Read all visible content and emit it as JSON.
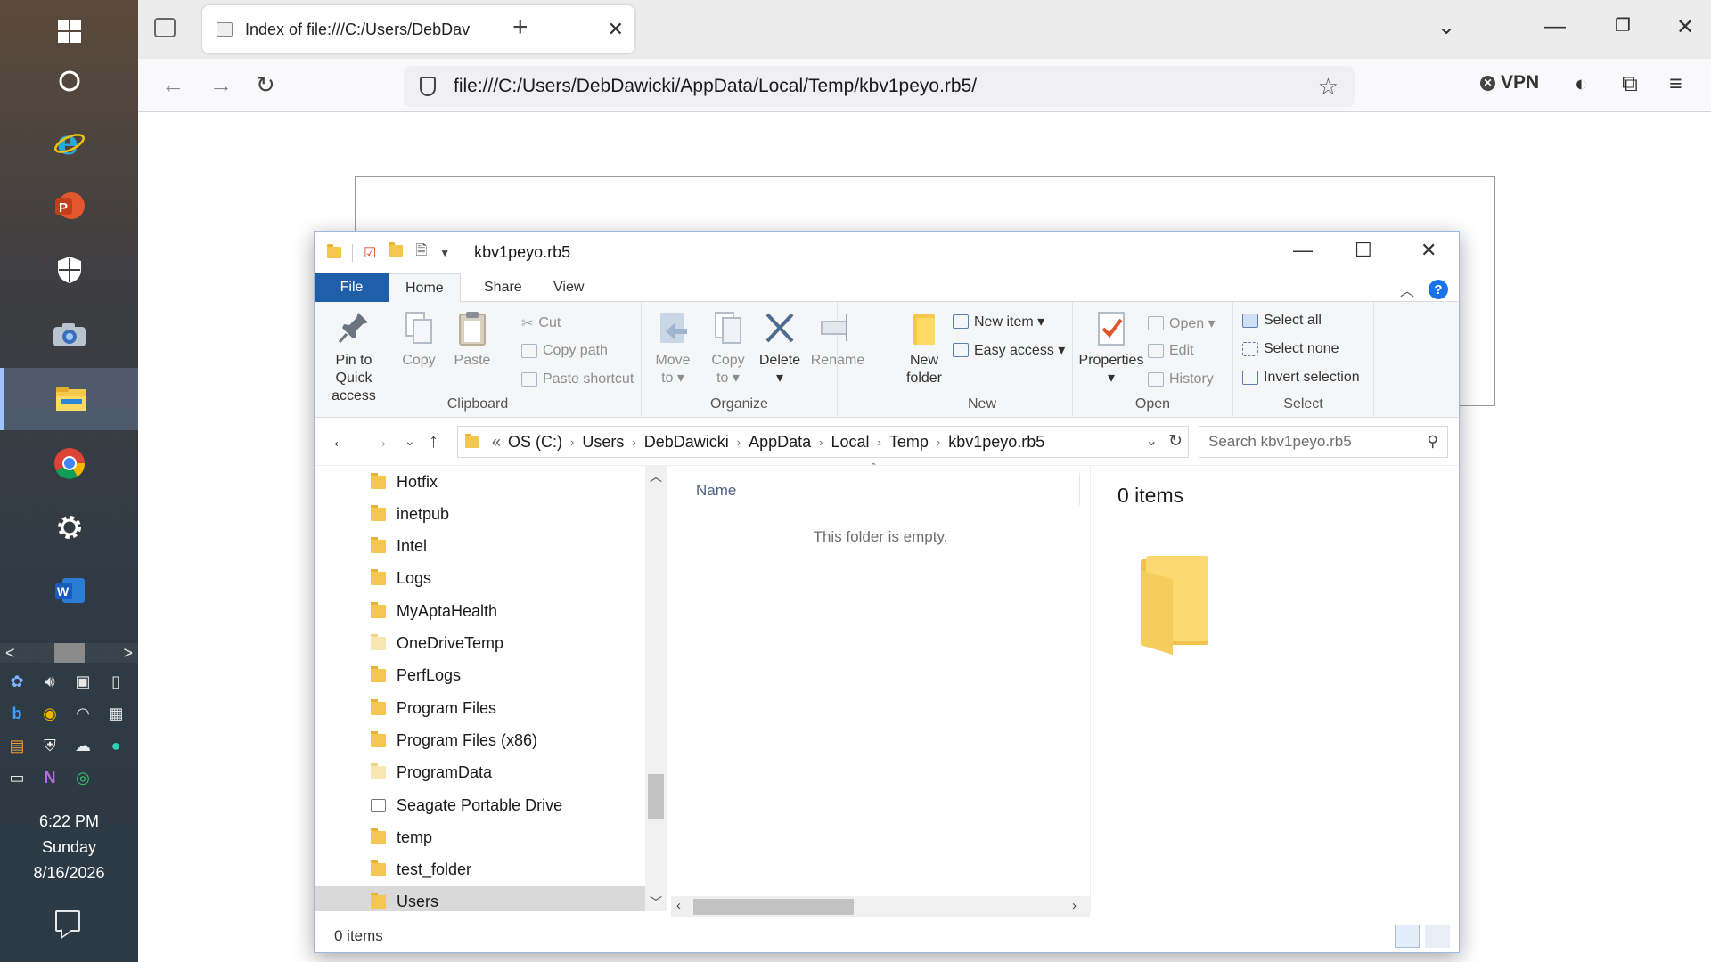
{
  "taskbar": {
    "icons": [
      "windows-start-icon",
      "cortana-icon",
      "internet-explorer-icon",
      "powerpoint-icon",
      "windows-security-icon",
      "camera-icon",
      "file-explorer-icon",
      "chrome-icon",
      "settings-icon",
      "word-icon"
    ],
    "tray_icons": [
      "copilot-icon",
      "volume-icon",
      "meet-now-icon",
      "battery-icon",
      "bing-icon",
      "chrome-icon",
      "wifi-icon",
      "camera-app-icon",
      "app-icon",
      "security-icon",
      "onedrive-icon",
      "app-icon",
      "drive-icon",
      "onenote-icon",
      "app-icon"
    ],
    "clock": {
      "time": "6:22 PM",
      "day": "Sunday",
      "date": "8/16/2026"
    }
  },
  "browser": {
    "tab_title": "Index of file:///C:/Users/DebDav",
    "tab_close": "✕",
    "new_tab": "+",
    "url": "file:///C:/Users/DebDawicki/AppData/Local/Temp/kbv1peyo.rb5/",
    "vpn_label": "VPN"
  },
  "explorer": {
    "window_title": "kbv1peyo.rb5",
    "ribbon_tabs": [
      "File",
      "Home",
      "Share",
      "View"
    ],
    "clipboard": {
      "pin_line1": "Pin to Quick",
      "pin_line2": "access",
      "copy": "Copy",
      "paste": "Paste",
      "cut": "Cut",
      "copy_path": "Copy path",
      "paste_shortcut": "Paste shortcut",
      "label": "Clipboard"
    },
    "organize": {
      "move_line1": "Move",
      "move_line2": "to ▾",
      "copy_line1": "Copy",
      "copy_line2": "to ▾",
      "delete": "Delete",
      "rename": "Rename",
      "label": "Organize"
    },
    "new": {
      "new_folder_line1": "New",
      "new_folder_line2": "folder",
      "new_item": "New item ▾",
      "easy_access": "Easy access ▾",
      "label": "New"
    },
    "open": {
      "properties": "Properties",
      "open": "Open ▾",
      "edit": "Edit",
      "history": "History",
      "label": "Open"
    },
    "select": {
      "select_all": "Select all",
      "select_none": "Select none",
      "invert_selection": "Invert selection",
      "label": "Select"
    },
    "breadcrumb": [
      "OS (C:)",
      "Users",
      "DebDawicki",
      "AppData",
      "Local",
      "Temp",
      "kbv1peyo.rb5"
    ],
    "breadcrumb_prefix": "«",
    "search_placeholder": "Search kbv1peyo.rb5",
    "nav_items": [
      {
        "label": "Hotfix",
        "icon": "folder"
      },
      {
        "label": "inetpub",
        "icon": "folder"
      },
      {
        "label": "Intel",
        "icon": "folder"
      },
      {
        "label": "Logs",
        "icon": "folder"
      },
      {
        "label": "MyAptaHealth",
        "icon": "folder"
      },
      {
        "label": "OneDriveTemp",
        "icon": "folder-light"
      },
      {
        "label": "PerfLogs",
        "icon": "folder"
      },
      {
        "label": "Program Files",
        "icon": "folder"
      },
      {
        "label": "Program Files (x86)",
        "icon": "folder"
      },
      {
        "label": "ProgramData",
        "icon": "folder-light"
      },
      {
        "label": "Seagate Portable Drive",
        "icon": "drive"
      },
      {
        "label": "temp",
        "icon": "folder"
      },
      {
        "label": "test_folder",
        "icon": "folder"
      },
      {
        "label": "Users",
        "icon": "folder",
        "selected": true
      }
    ],
    "column_name": "Name",
    "empty_message": "This folder is empty.",
    "preview_count": "0 items",
    "status_text": "0 items"
  }
}
